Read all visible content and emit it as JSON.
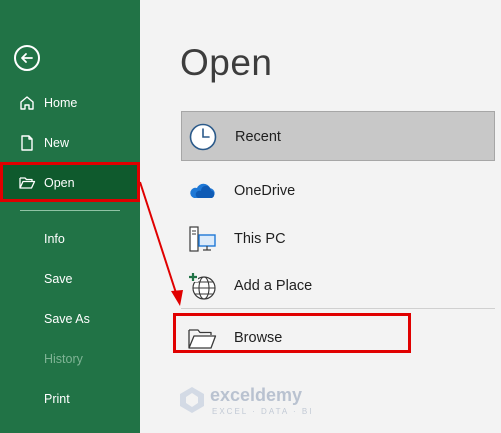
{
  "sidebar": {
    "items": [
      {
        "label": "Home"
      },
      {
        "label": "New"
      },
      {
        "label": "Open"
      },
      {
        "label": "Info"
      },
      {
        "label": "Save"
      },
      {
        "label": "Save As"
      },
      {
        "label": "History"
      },
      {
        "label": "Print"
      }
    ]
  },
  "main": {
    "title": "Open",
    "locations": [
      {
        "label": "Recent"
      },
      {
        "label": "OneDrive"
      },
      {
        "label": "This PC"
      },
      {
        "label": "Add a Place"
      },
      {
        "label": "Browse"
      }
    ]
  },
  "watermark": {
    "name": "exceldemy",
    "tagline": "EXCEL · DATA · BI"
  },
  "colors": {
    "sidebar_bg": "#217346",
    "selected_bg": "#0f5a2d",
    "highlight": "#e00000"
  }
}
